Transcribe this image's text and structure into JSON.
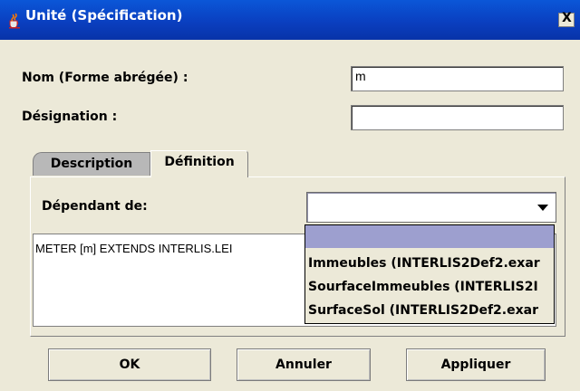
{
  "window": {
    "title": "Unité (Spécification)",
    "close_label": "X"
  },
  "form": {
    "name_label": "Nom (Forme abrégée) :",
    "name_value": "m",
    "designation_label": "Désignation :",
    "designation_value": ""
  },
  "tabs": [
    {
      "label": "Description",
      "active": false
    },
    {
      "label": "Définition",
      "active": true
    }
  ],
  "definition": {
    "dependant_label": "Dépendant de:",
    "combo_value": "",
    "text": "METER [m] EXTENDS INTERLIS.LEI",
    "dropdown_options": [
      {
        "label": "",
        "selected": true
      },
      {
        "label": "Immeubles (INTERLIS2Def2.exar",
        "selected": false
      },
      {
        "label": "SourfaceImmeubles (INTERLIS2I",
        "selected": false
      },
      {
        "label": "SurfaceSol (INTERLIS2Def2.exar",
        "selected": false
      }
    ]
  },
  "buttons": {
    "ok": "OK",
    "cancel": "Annuler",
    "apply": "Appliquer"
  },
  "colors": {
    "titlebar": "#0a3fc0",
    "selection": "#9d9fcf",
    "background": "#ece9d8"
  },
  "icons": {
    "title": "java-cup-icon",
    "combo": "chevron-down-icon"
  }
}
